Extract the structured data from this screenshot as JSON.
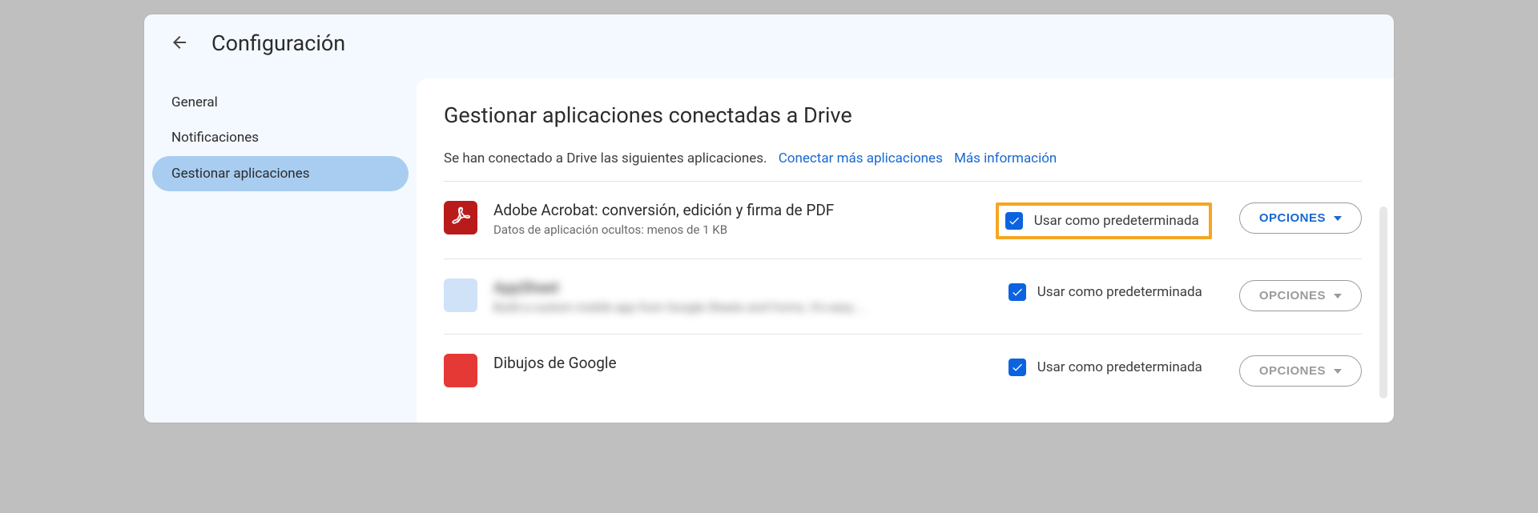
{
  "header": {
    "title": "Configuración"
  },
  "sidebar": {
    "items": [
      {
        "label": "General",
        "active": false
      },
      {
        "label": "Notificaciones",
        "active": false
      },
      {
        "label": "Gestionar aplicaciones",
        "active": true
      }
    ]
  },
  "main": {
    "title": "Gestionar aplicaciones conectadas a Drive",
    "intro_text": "Se han conectado a Drive las siguientes aplicaciones.",
    "link_connect": "Conectar más aplicaciones",
    "link_more_info": "Más información",
    "options_label": "OPCIONES",
    "default_label": "Usar como predeterminada",
    "apps": [
      {
        "icon": "acrobat",
        "name": "Adobe Acrobat: conversión, edición y firma de PDF",
        "meta": "Datos de aplicación ocultos: menos de 1 KB",
        "default_checked": true,
        "highlight": true,
        "options_enabled": true,
        "blurred": false
      },
      {
        "icon": "placeholder",
        "name": "AppSheet",
        "meta": "Build a custom mobile app from Google Sheets and Forms. It's easy …",
        "default_checked": true,
        "highlight": false,
        "options_enabled": false,
        "blurred": true
      },
      {
        "icon": "drawings",
        "name": "Dibujos de Google",
        "meta": "",
        "default_checked": true,
        "highlight": false,
        "options_enabled": false,
        "blurred": false
      }
    ]
  }
}
